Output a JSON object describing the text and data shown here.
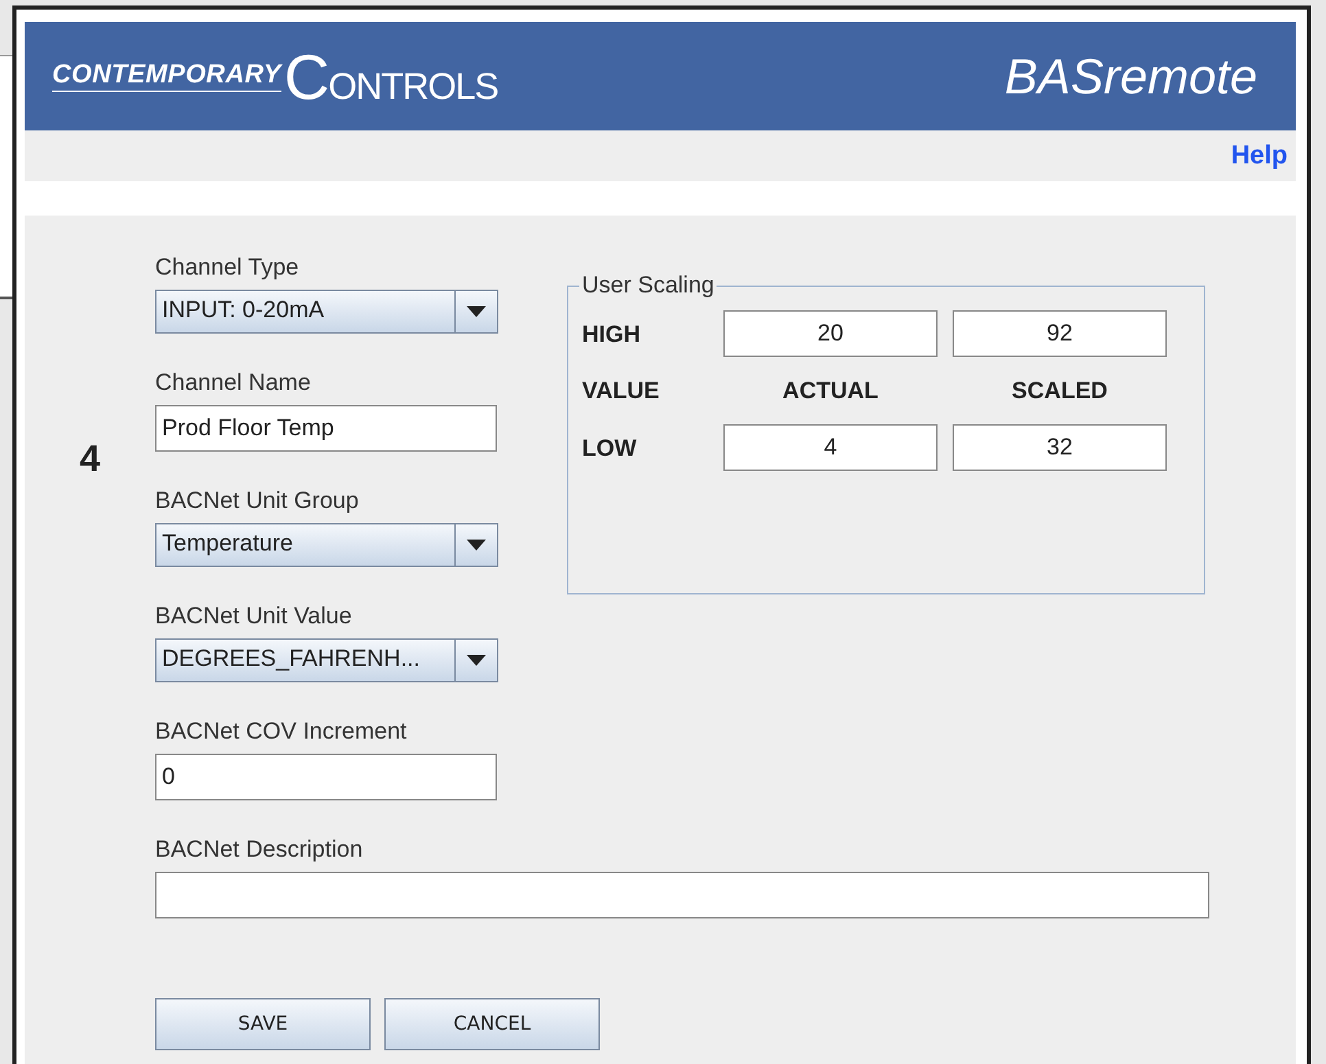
{
  "header": {
    "logo_left": "CONTEMPORARY",
    "logo_right": "CONTROLS",
    "product": "BASremote"
  },
  "help_link": "Help",
  "channel_number": "4",
  "fields": [
    {
      "kind": "select",
      "label": "Channel Type",
      "value": "INPUT: 0-20mA"
    },
    {
      "kind": "text",
      "label": "Channel Name",
      "value": "Prod Floor Temp"
    },
    {
      "kind": "select",
      "label": "BACNet Unit Group",
      "value": "Temperature"
    },
    {
      "kind": "select",
      "label": "BACNet Unit Value",
      "value": "DEGREES_FAHRENH..."
    },
    {
      "kind": "text",
      "label": "BACNet COV Increment",
      "value": "0"
    }
  ],
  "description": {
    "label": "BACNet Description"
  },
  "user_scaling": {
    "title": "User Scaling",
    "high_label": "HIGH",
    "value_label": "VALUE",
    "actual_label": "ACTUAL",
    "scaled_label": "SCALED",
    "low_label": "LOW",
    "high_actual": "20",
    "high_scaled": "92",
    "low_actual": "4",
    "low_scaled": "32"
  },
  "buttons": [
    "SAVE",
    "CANCEL"
  ]
}
